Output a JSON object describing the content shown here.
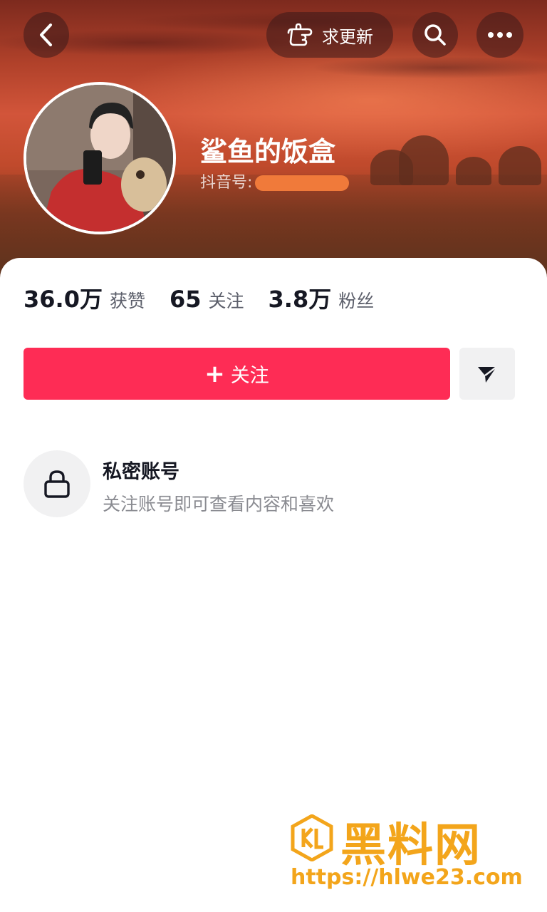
{
  "header": {
    "update_button_label": "求更新",
    "username": "鲨鱼的饭盒",
    "douyin_id_label": "抖音号:"
  },
  "stats": [
    {
      "value": "36.0万",
      "label": "获赞"
    },
    {
      "value": "65",
      "label": "关注"
    },
    {
      "value": "3.8万",
      "label": "粉丝"
    }
  ],
  "actions": {
    "follow_label": "关注"
  },
  "private_notice": {
    "title": "私密账号",
    "description": "关注账号即可查看内容和喜欢"
  },
  "watermark": {
    "brand": "黑料网",
    "url": "https://hlwe23.com"
  },
  "colors": {
    "accent": "#fe2c55",
    "watermark": "#f3a51b"
  },
  "icons": [
    "chevron-left-icon",
    "pointing-hand-icon",
    "search-icon",
    "more-icon",
    "send-icon",
    "lock-icon"
  ]
}
